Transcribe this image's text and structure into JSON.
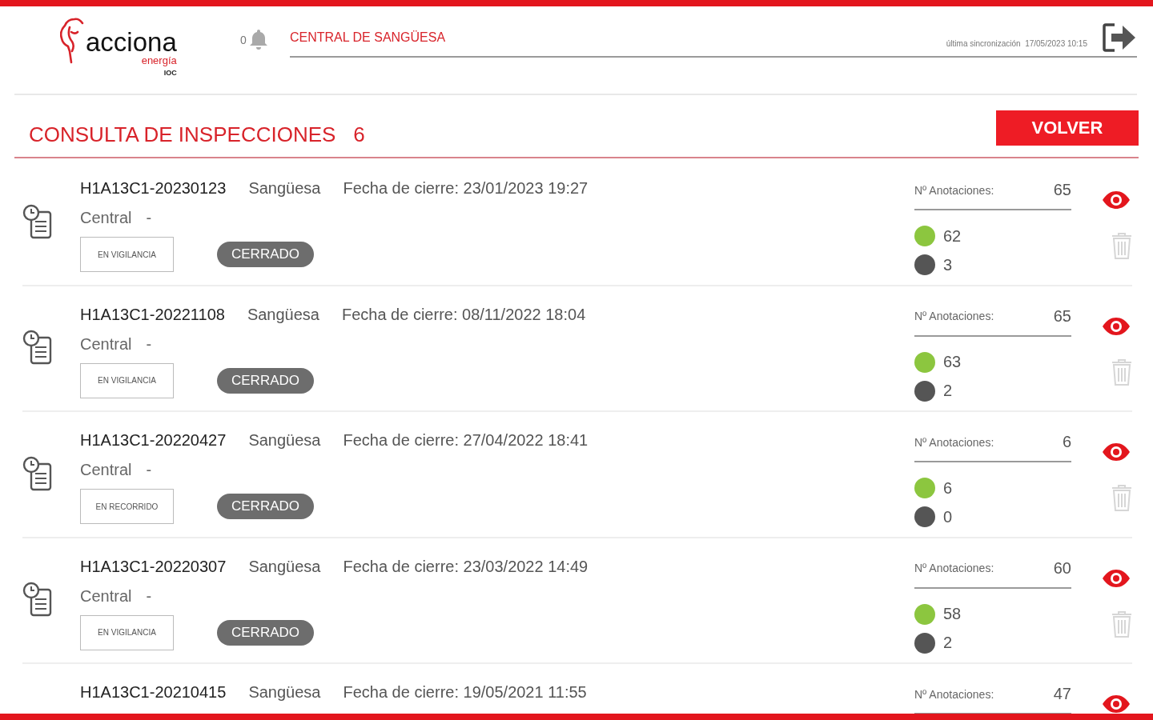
{
  "header": {
    "logo": {
      "name": "acciona",
      "sub": "energía",
      "tag": "IOC"
    },
    "bell_count": "0",
    "plant": "CENTRAL DE SANGÜESA",
    "sync_label": "última sincronización",
    "sync_time": "17/05/2023 10:15"
  },
  "title": "CONSULTA DE INSPECCIONES",
  "count": "6",
  "back_button": "VOLVER",
  "inspections": [
    {
      "code": "H1A13C1-20230123",
      "place": "Sangüesa",
      "closed": "Fecha de cierre: 23/01/2023 19:27",
      "type": "Central",
      "separator": "-",
      "phase": "EN VIGILANCIA",
      "status": "CERRADO",
      "notes_label": "Nº Anotaciones:",
      "notes_total": "65",
      "counts": [
        {
          "value": "62",
          "color": "#8cc63f"
        },
        {
          "value": "3",
          "color": "#555555"
        }
      ]
    },
    {
      "code": "H1A13C1-20221108",
      "place": "Sangüesa",
      "closed": "Fecha de cierre: 08/11/2022 18:04",
      "type": "Central",
      "separator": "-",
      "phase": "EN VIGILANCIA",
      "status": "CERRADO",
      "notes_label": "Nº Anotaciones:",
      "notes_total": "65",
      "counts": [
        {
          "value": "63",
          "color": "#8cc63f"
        },
        {
          "value": "2",
          "color": "#555555"
        }
      ]
    },
    {
      "code": "H1A13C1-20220427",
      "place": "Sangüesa",
      "closed": "Fecha de cierre: 27/04/2022 18:41",
      "type": "Central",
      "separator": "-",
      "phase": "EN RECORRIDO",
      "status": "CERRADO",
      "notes_label": "Nº Anotaciones:",
      "notes_total": "6",
      "counts": [
        {
          "value": "6",
          "color": "#8cc63f"
        },
        {
          "value": "0",
          "color": "#555555"
        }
      ]
    },
    {
      "code": "H1A13C1-20220307",
      "place": "Sangüesa",
      "closed": "Fecha de cierre: 23/03/2022 14:49",
      "type": "Central",
      "separator": "-",
      "phase": "EN VIGILANCIA",
      "status": "CERRADO",
      "notes_label": "Nº Anotaciones:",
      "notes_total": "60",
      "counts": [
        {
          "value": "58",
          "color": "#8cc63f"
        },
        {
          "value": "2",
          "color": "#555555"
        }
      ]
    },
    {
      "code": "H1A13C1-20210415",
      "place": "Sangüesa",
      "closed": "Fecha de cierre: 19/05/2021 11:55",
      "notes_label": "Nº Anotaciones:",
      "notes_total": "47"
    }
  ]
}
